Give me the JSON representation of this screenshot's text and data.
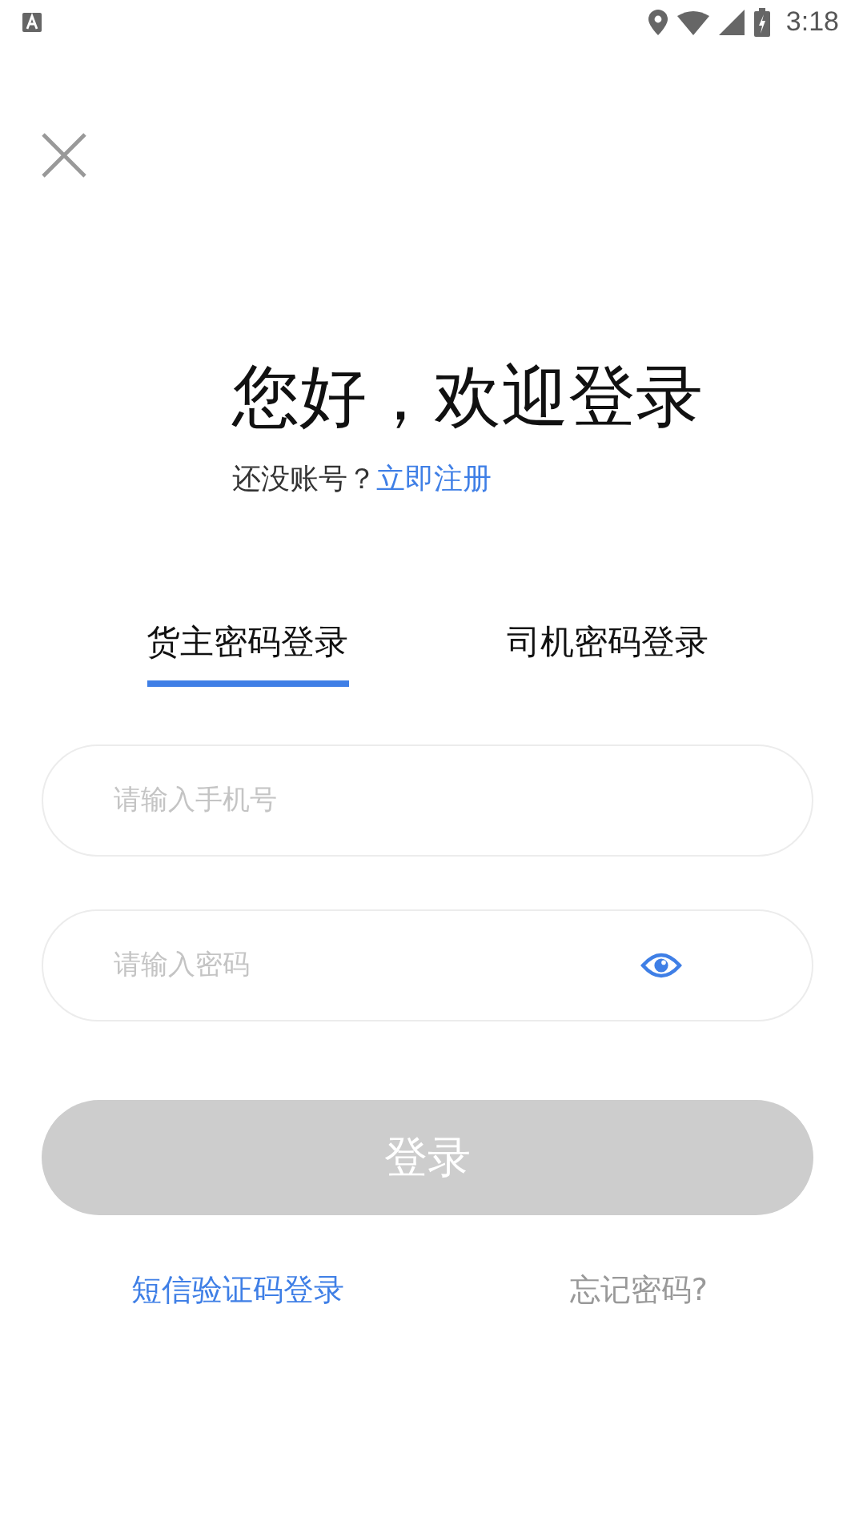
{
  "status_bar": {
    "time": "3:18"
  },
  "title": "您好，欢迎登录",
  "register": {
    "prompt": "还没账号？",
    "link": "立即注册"
  },
  "tabs": [
    {
      "label": "货主密码登录",
      "selected": true
    },
    {
      "label": "司机密码登录",
      "selected": false
    }
  ],
  "phone_field": {
    "placeholder": "请输入手机号"
  },
  "password_field": {
    "placeholder": "请输入密码"
  },
  "login_button": {
    "label": "登录",
    "disabled": true
  },
  "sms_login_link": "短信验证码登录",
  "forgot_password_link": "忘记密码?"
}
